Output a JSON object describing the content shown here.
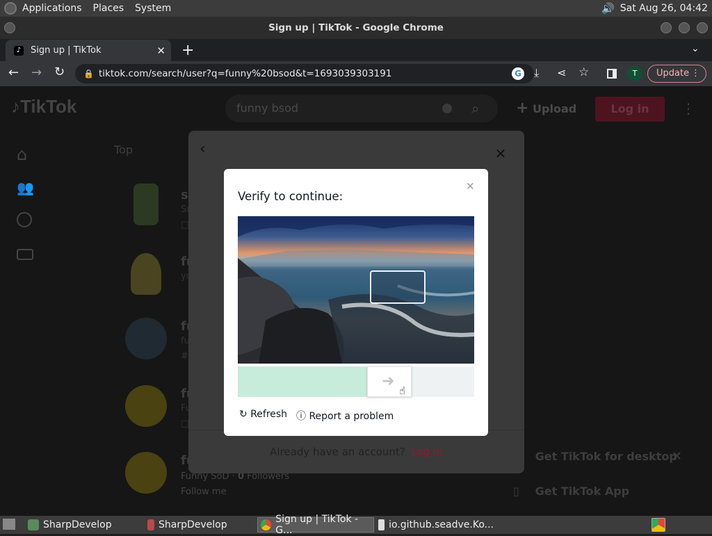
{
  "panel": {
    "menus": [
      "Applications",
      "Places",
      "System"
    ],
    "datetime": "Sat Aug 26, 04:42"
  },
  "window": {
    "title": "Sign up | TikTok - Google Chrome"
  },
  "browser": {
    "tab_title": "Sign up | TikTok",
    "url": "tiktok.com/search/user?q=funny%20bsod&t=1693039303191",
    "profile_initial": "T",
    "update_label": "Update"
  },
  "tiktok": {
    "logo_text": "TikTok",
    "search_value": "funny bsod",
    "upload_label": "Upload",
    "login_label": "Log in",
    "tab_top": "Top",
    "results": [
      {
        "name": "s",
        "sub": "Sı",
        "extra": "□"
      },
      {
        "name": "fu",
        "sub": "yo",
        "extra": ""
      },
      {
        "name": "fu",
        "sub": "fu",
        "extra": "#"
      },
      {
        "name": "fu",
        "sub": "Fu",
        "extra": "□"
      },
      {
        "name": "fu",
        "sub": "Funny SoD · ",
        "followers": "0",
        "followers_label": "Followers",
        "extra": "Follow me"
      }
    ],
    "desktop_banner": "Get TikTok for desktop",
    "app_banner": "Get TikTok App",
    "already_account": "Already have an account?",
    "already_login": "Log in"
  },
  "captcha": {
    "title": "Verify to continue:",
    "refresh_label": "Refresh",
    "report_label": "Report a problem",
    "slider_progress": 0.55
  },
  "taskbar": {
    "items": [
      "SharpDevelop",
      "SharpDevelop",
      "Sign up | TikTok - G...",
      "io.github.seadve.Ko..."
    ]
  },
  "colors": {
    "accent": "#fe2c55",
    "slider_fill": "#c7ecdc"
  }
}
